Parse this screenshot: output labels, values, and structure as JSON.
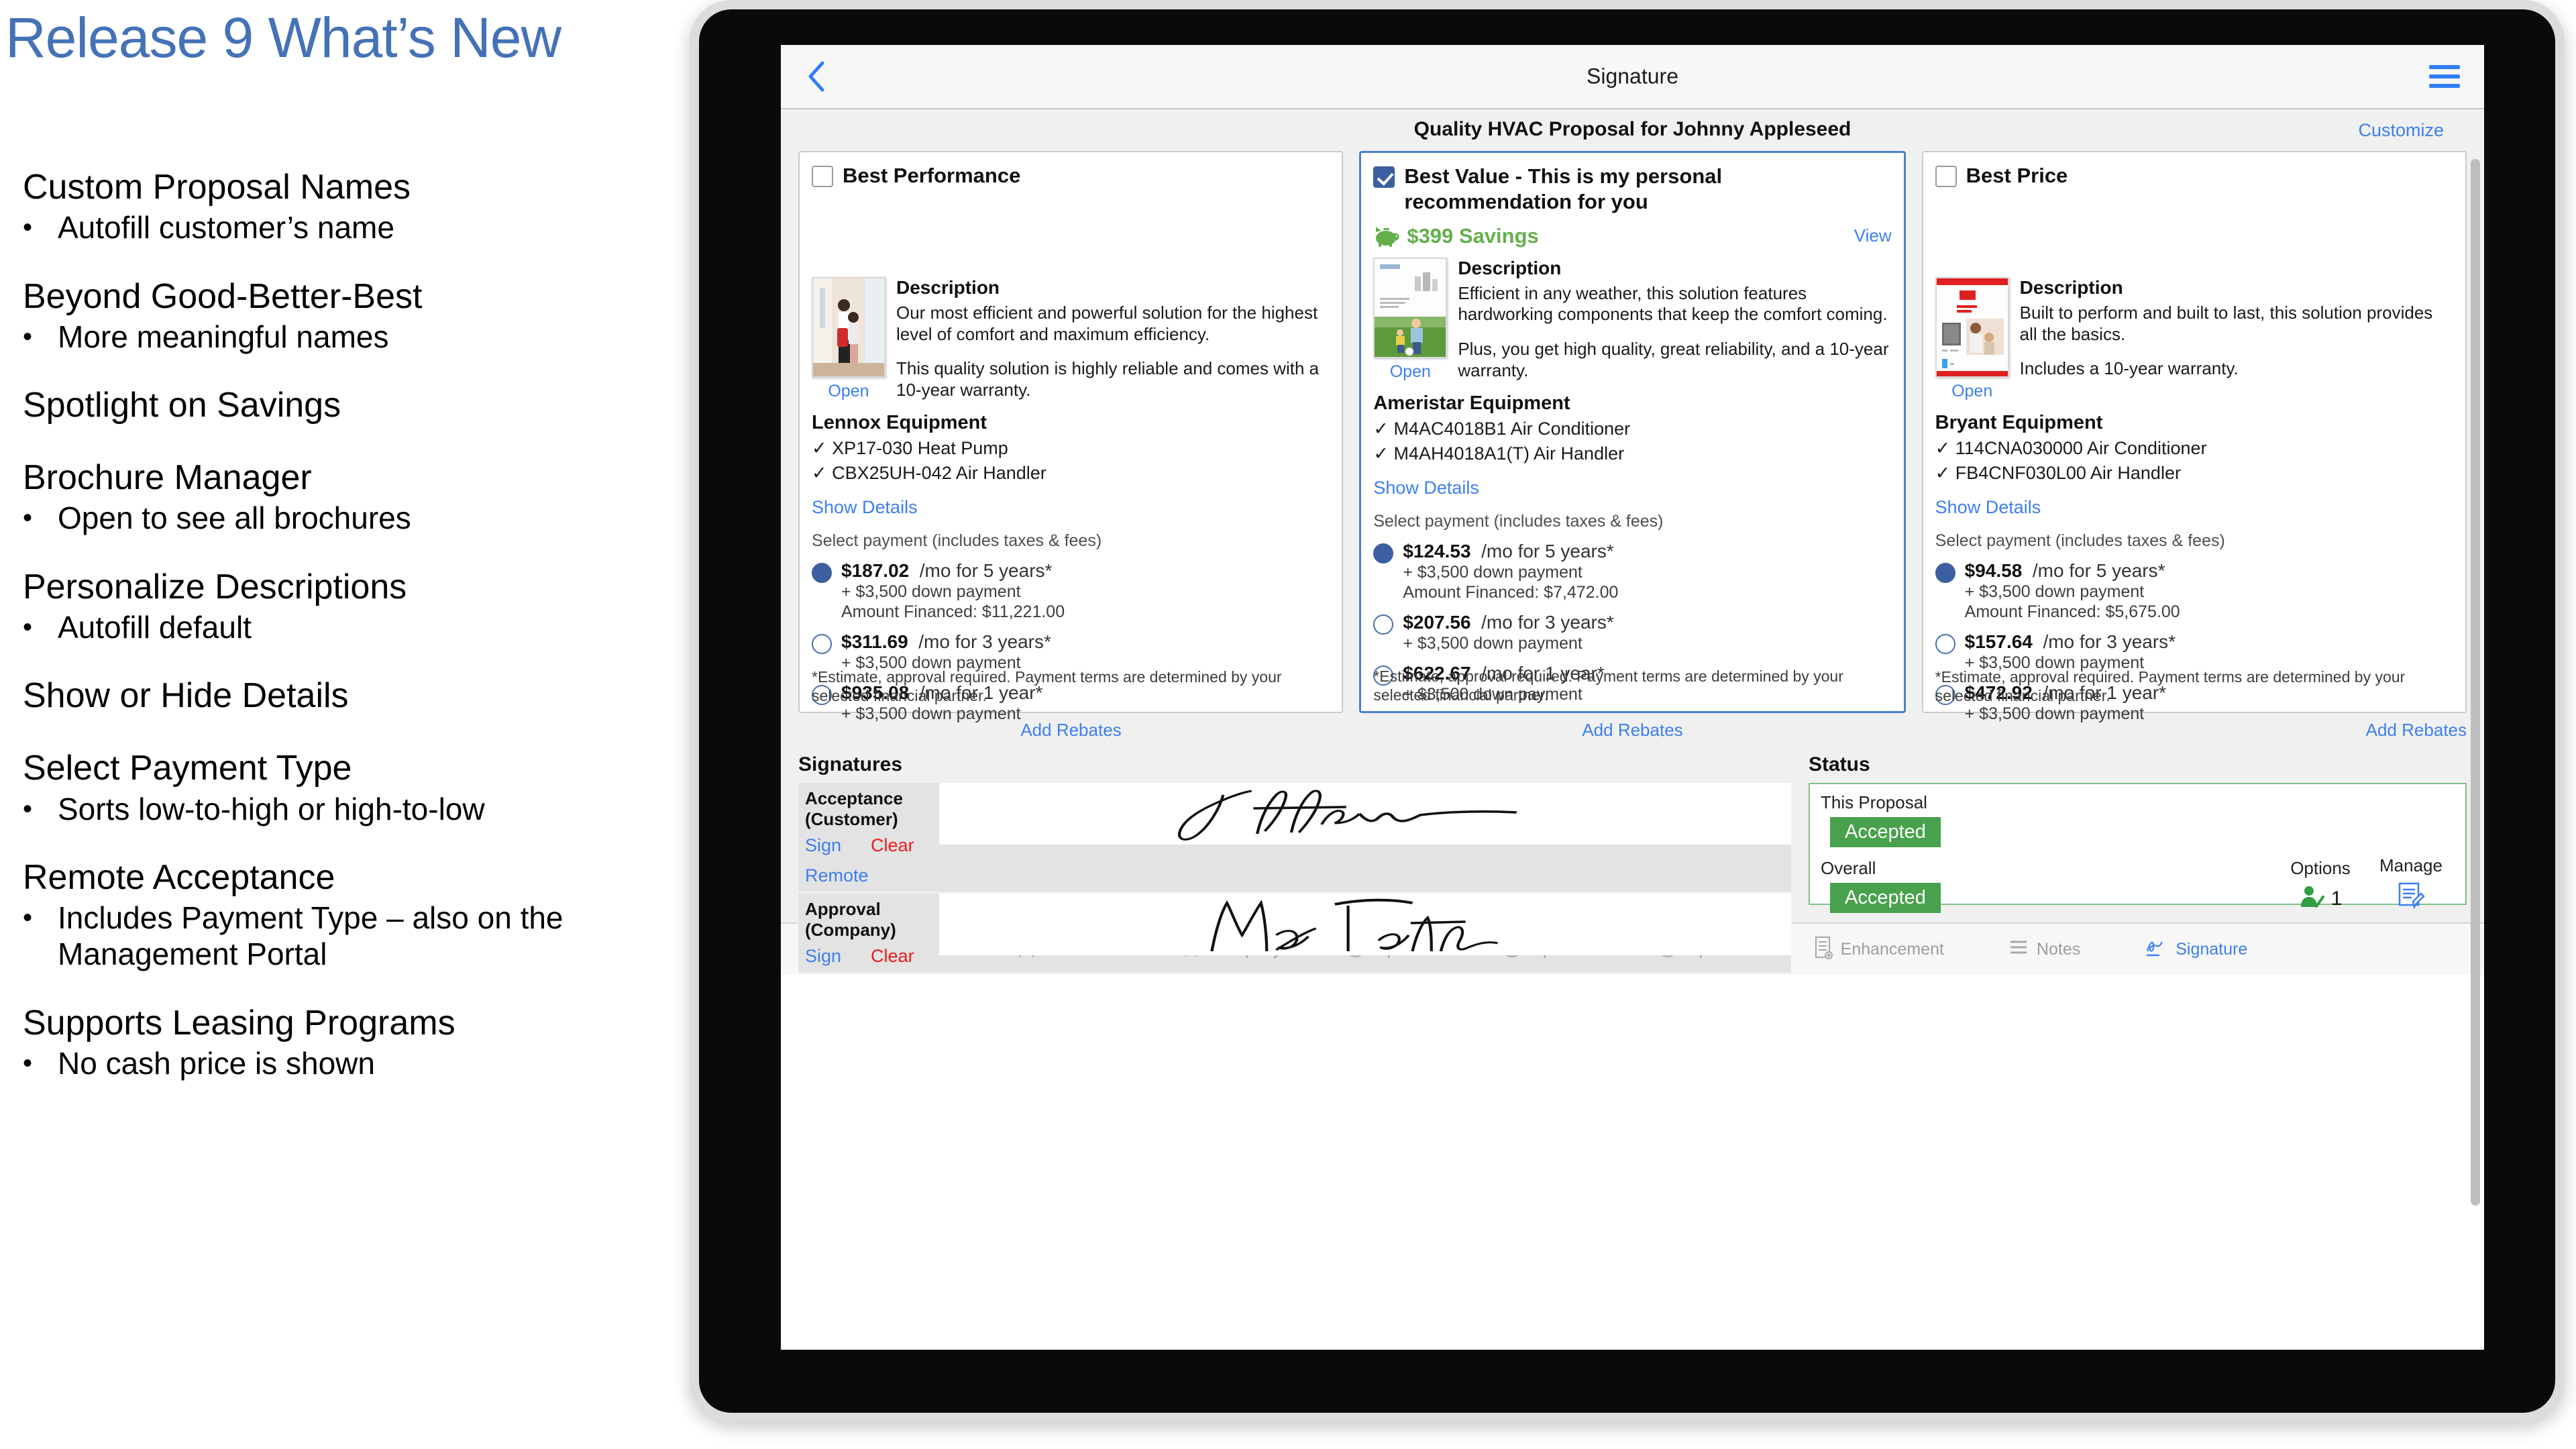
{
  "slide": {
    "title": "Release 9 What’s New",
    "sections": [
      {
        "heading": "Custom Proposal Names",
        "bullets": [
          "Autofill customer’s name"
        ]
      },
      {
        "heading": "Beyond Good-Better-Best",
        "bullets": [
          "More meaningful names"
        ]
      },
      {
        "heading": "Spotlight on Savings",
        "bullets": []
      },
      {
        "heading": "Brochure Manager",
        "bullets": [
          "Open to see all brochures"
        ]
      },
      {
        "heading": "Personalize Descriptions",
        "bullets": [
          "Autofill default"
        ]
      },
      {
        "heading": "Show or Hide Details",
        "bullets": []
      },
      {
        "heading": "Select Payment Type",
        "bullets": [
          "Sorts low-to-high or high-to-low"
        ]
      },
      {
        "heading": "Remote Acceptance",
        "bullets": [
          "Includes Payment Type – also on the Management Portal"
        ]
      },
      {
        "heading": "Supports Leasing Programs",
        "bullets": [
          "No cash price is shown"
        ]
      }
    ]
  },
  "app": {
    "nav": {
      "back_icon": "chevron-left-icon",
      "title": "Signature",
      "menu_icon": "hamburger-menu-icon"
    },
    "proposal": {
      "title": "Quality HVAC Proposal for Johnny Appleseed",
      "customize_label": "Customize"
    },
    "columns": [
      {
        "id": "best-performance",
        "checkbox_checked": false,
        "title": "Best Performance",
        "savings": null,
        "view_label": null,
        "thumb_kind": "photo-family-doorway",
        "open_label": "Open",
        "description_heading": "Description",
        "description_paragraphs": [
          "Our most efficient and powerful solution for the highest level of comfort and maximum efficiency.",
          "This quality solution is highly reliable and comes with a 10-year warranty."
        ],
        "equipment_heading": "Lennox Equipment",
        "equipment_items": [
          "✓ XP17-030 Heat Pump",
          "✓ CBX25UH-042 Air Handler"
        ],
        "show_details_label": "Show Details",
        "select_payment_label": "Select payment (includes taxes & fees)",
        "payments": [
          {
            "selected": true,
            "amount": "$187.02",
            "term": "/mo for 5 years*",
            "down": "+ $3,500 down payment",
            "financed": "Amount Financed: $11,221.00"
          },
          {
            "selected": false,
            "amount": "$311.69",
            "term": "/mo for 3 years*",
            "down": "+ $3,500 down payment",
            "financed": null
          },
          {
            "selected": false,
            "amount": "$935.08",
            "term": "/mo for 1 year*",
            "down": "+ $3,500 down payment",
            "financed": null
          }
        ],
        "estimate_note": "*Estimate, approval required. Payment terms are determined by your selected financial partner.",
        "add_rebates_label": "Add Rebates"
      },
      {
        "id": "best-value",
        "checkbox_checked": true,
        "title": "Best Value - This is my personal recommendation for you",
        "savings": "$399 Savings",
        "savings_icon": "piggy-bank-icon",
        "view_label": "View",
        "thumb_kind": "brochure-ameristar",
        "open_label": "Open",
        "description_heading": "Description",
        "description_paragraphs": [
          "Efficient in any weather, this solution features hardworking components that keep the comfort coming.",
          "Plus, you get high quality, great reliability, and a 10-year warranty."
        ],
        "equipment_heading": "Ameristar Equipment",
        "equipment_items": [
          "✓ M4AC4018B1 Air Conditioner",
          "✓ M4AH4018A1(T) Air Handler"
        ],
        "show_details_label": "Show Details",
        "select_payment_label": "Select payment (includes taxes & fees)",
        "payments": [
          {
            "selected": true,
            "amount": "$124.53",
            "term": "/mo for 5 years*",
            "down": "+ $3,500 down payment",
            "financed": "Amount Financed: $7,472.00"
          },
          {
            "selected": false,
            "amount": "$207.56",
            "term": "/mo for 3 years*",
            "down": "+ $3,500 down payment",
            "financed": null
          },
          {
            "selected": false,
            "amount": "$622.67",
            "term": "/mo for 1 year*",
            "down": "+ $3,500 down payment",
            "financed": null
          }
        ],
        "estimate_note": "*Estimate, approval required. Payment terms are determined by your selected financial partner.",
        "add_rebates_label": "Add Rebates"
      },
      {
        "id": "best-price",
        "checkbox_checked": false,
        "title": "Best Price",
        "savings": null,
        "view_label": null,
        "thumb_kind": "brochure-bryant",
        "open_label": "Open",
        "description_heading": "Description",
        "description_paragraphs": [
          "Built to perform and built to last, this solution provides all the basics.",
          "Includes a 10-year warranty."
        ],
        "equipment_heading": "Bryant Equipment",
        "equipment_items": [
          "✓ 114CNA030000 Air Conditioner",
          "✓ FB4CNF030L00 Air Handler"
        ],
        "show_details_label": "Show Details",
        "select_payment_label": "Select payment (includes taxes & fees)",
        "payments": [
          {
            "selected": true,
            "amount": "$94.58",
            "term": "/mo for 5 years*",
            "down": "+ $3,500 down payment",
            "financed": "Amount Financed: $5,675.00"
          },
          {
            "selected": false,
            "amount": "$157.64",
            "term": "/mo for 3 years*",
            "down": "+ $3,500 down payment",
            "financed": null
          },
          {
            "selected": false,
            "amount": "$472.92",
            "term": "/mo for 1 year*",
            "down": "+ $3,500 down payment",
            "financed": null
          }
        ],
        "estimate_note": "*Estimate, approval required. Payment terms are determined by your selected financial partner.",
        "add_rebates_label": "Add Rebates"
      }
    ],
    "signatures": {
      "heading": "Signatures",
      "rows": [
        {
          "label": "Acceptance (Customer)",
          "sign_label": "Sign",
          "clear_label": "Clear",
          "remote_label": "Remote",
          "signature_text": "J. Appleseed"
        },
        {
          "label": "Approval (Company)",
          "sign_label": "Sign",
          "clear_label": "Clear",
          "remote_label": null,
          "signature_text": "Max Tetra"
        }
      ]
    },
    "status": {
      "heading": "Status",
      "this_proposal_label": "This Proposal",
      "this_proposal_value": "Accepted",
      "overall_label": "Overall",
      "overall_value": "Accepted",
      "options_label": "Options",
      "options_value": "1",
      "options_icon": "person-check-icon",
      "manage_label": "Manage",
      "manage_icon": "document-edit-icon"
    },
    "tabs": [
      {
        "id": "customer",
        "label": "Customer",
        "icon": "person-icon",
        "active": false
      },
      {
        "id": "company",
        "label": "Company",
        "icon": "truck-icon",
        "active": false
      },
      {
        "id": "option-1",
        "label": "Option 1",
        "icon": "circle-1-icon",
        "active": false
      },
      {
        "id": "option-2",
        "label": "Option 2",
        "icon": "circle-2-icon",
        "active": false
      },
      {
        "id": "option-3",
        "label": "Option 3",
        "icon": "circle-3-icon",
        "active": false
      },
      {
        "id": "enhancement",
        "label": "Enhancement",
        "icon": "list-add-icon",
        "active": false
      },
      {
        "id": "notes",
        "label": "Notes",
        "icon": "lines-icon",
        "active": false
      },
      {
        "id": "signature",
        "label": "Signature",
        "icon": "signature-icon",
        "active": true
      }
    ]
  },
  "colors": {
    "title_blue": "#4472B8",
    "link_blue": "#3c7ff0",
    "clear_red": "#ee1b1b",
    "savings_green": "#63b04a",
    "accepted_green": "#48a14c",
    "checkbox_navy": "#3b5fa0"
  }
}
